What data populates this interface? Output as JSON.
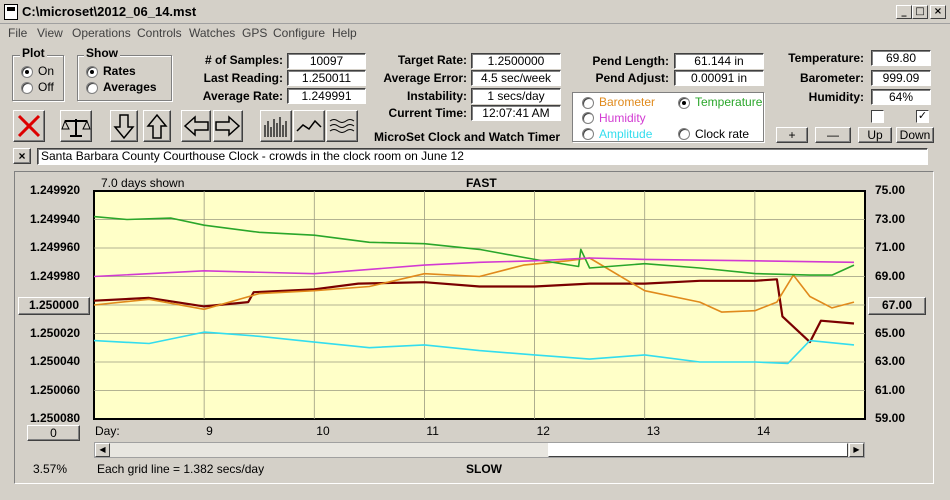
{
  "window": {
    "title": "C:\\microset\\2012_06_14.mst"
  },
  "menu": [
    "File",
    "View",
    "Operations",
    "Controls",
    "Watches",
    "GPS",
    "Configure",
    "Help"
  ],
  "plot": {
    "title": "Plot",
    "on": "On",
    "off": "Off",
    "selected": "On"
  },
  "show": {
    "title": "Show",
    "rates": "Rates",
    "averages": "Averages",
    "selected": "Rates"
  },
  "stats": {
    "samples_label": "# of Samples:",
    "samples": "10097",
    "last_label": "Last Reading:",
    "last": "1.250011",
    "avg_label": "Average Rate:",
    "avg": "1.249991",
    "target_label": "Target Rate:",
    "target": "1.2500000",
    "avg_error_label": "Average Error:",
    "avg_error": "4.5 sec/week",
    "instability_label": "Instability:",
    "instability": "1 secs/day",
    "current_time_label": "Current Time:",
    "current_time": "12:07:41 AM",
    "pend_length_label": "Pend Length:",
    "pend_length": "61.144 in",
    "pend_adjust_label": "Pend Adjust:",
    "pend_adjust": "0.00091 in",
    "temperature_label": "Temperature:",
    "temperature": "69.80",
    "barometer_label": "Barometer:",
    "barometer": "999.09",
    "humidity_label": "Humidity:",
    "humidity": "64%"
  },
  "app_caption": "MicroSet Clock and Watch Timer",
  "sensor_select": {
    "barometer": "Barometer",
    "temperature": "Temperature",
    "humidity": "Humidity",
    "amplitude": "Amplitude",
    "clock_rate": "Clock rate",
    "selected": "Temperature"
  },
  "small_buttons": {
    "plus": "+",
    "minus": "—",
    "up": "Up",
    "down": "Down"
  },
  "description": "Santa Barbara County Courthouse Clock - crowds in the clock room on June 12",
  "chart_header": {
    "days_shown": "7.0 days shown",
    "fast": "FAST",
    "slow": "SLOW",
    "grid_note": "Each grid line = 1.382 secs/day",
    "percent": "3.57%"
  },
  "left_center_button": "1.250000",
  "right_center_button": "67.00",
  "offset_button": "0",
  "colors": {
    "plot_bg": "#ffffc8",
    "rate": "#7a0000",
    "average": "#e08a1c",
    "temperature": "#2aa62a",
    "humidity": "#d23ad2",
    "amplitude": "#33ddee"
  },
  "chart_data": {
    "type": "line",
    "xlabel": "Day:",
    "x_ticks": [
      9,
      10,
      11,
      12,
      13,
      14
    ],
    "xlim": [
      8.0,
      15.0
    ],
    "ylim": [
      1.24992,
      1.25008
    ],
    "y_ticks": [
      "1.249920",
      "1.249940",
      "1.249960",
      "1.249980",
      "1.250000",
      "1.250020",
      "1.250040",
      "1.250060",
      "1.250080"
    ],
    "y2lim": [
      59.0,
      75.0
    ],
    "y2_ticks": [
      "75.00",
      "73.00",
      "71.00",
      "69.00",
      "67.00",
      "65.00",
      "63.00",
      "61.00",
      "59.00"
    ],
    "series": [
      {
        "key": "rate",
        "x": [
          8.0,
          8.5,
          9.0,
          9.4,
          9.45,
          10.0,
          10.4,
          11.0,
          11.5,
          12.0,
          12.5,
          13.0,
          13.5,
          14.0,
          14.2,
          14.25,
          14.5,
          14.6,
          14.9
        ],
        "y": [
          1.249997,
          1.249995,
          1.250001,
          1.249998,
          1.249991,
          1.249989,
          1.249985,
          1.249984,
          1.249987,
          1.249987,
          1.249985,
          1.249985,
          1.249983,
          1.249983,
          1.249982,
          1.250008,
          1.250026,
          1.250011,
          1.250013
        ]
      },
      {
        "key": "average",
        "x": [
          8.0,
          8.5,
          9.0,
          9.5,
          10.0,
          10.5,
          11.0,
          11.5,
          11.9,
          12.3,
          12.5,
          13.0,
          13.5,
          13.7,
          14.0,
          14.2,
          14.35,
          14.5,
          14.7,
          14.9
        ],
        "y": [
          1.25,
          1.249996,
          1.250003,
          1.249992,
          1.24999,
          1.249987,
          1.249978,
          1.24998,
          1.249972,
          1.249969,
          1.249967,
          1.24999,
          1.249998,
          1.250005,
          1.250004,
          1.249998,
          1.249979,
          1.249994,
          1.250002,
          1.249998
        ]
      },
      {
        "key": "temperature",
        "x": [
          8.0,
          8.3,
          8.7,
          9.0,
          9.5,
          10.0,
          10.5,
          11.0,
          11.5,
          12.0,
          12.4,
          12.42,
          12.5,
          13.0,
          13.5,
          14.0,
          14.5,
          14.7,
          14.9
        ],
        "y": [
          73.2,
          73.0,
          73.1,
          72.6,
          72.1,
          71.9,
          71.4,
          71.3,
          70.9,
          70.2,
          69.7,
          70.9,
          69.6,
          69.9,
          69.6,
          69.2,
          69.1,
          69.1,
          69.8
        ]
      },
      {
        "key": "humidity",
        "x": [
          8.0,
          9.0,
          10.0,
          11.0,
          11.5,
          12.0,
          12.5,
          13.0,
          14.0,
          14.9
        ],
        "y": [
          1.24998,
          1.249976,
          1.249978,
          1.249972,
          1.24997,
          1.249969,
          1.249967,
          1.249968,
          1.249969,
          1.24997
        ]
      },
      {
        "key": "amplitude",
        "x": [
          8.0,
          8.5,
          9.0,
          9.5,
          10.0,
          10.5,
          11.0,
          11.5,
          12.0,
          12.5,
          13.0,
          13.5,
          14.0,
          14.3,
          14.5,
          14.9
        ],
        "y": [
          1.250025,
          1.250027,
          1.250019,
          1.250022,
          1.250026,
          1.25003,
          1.250028,
          1.250032,
          1.250035,
          1.250038,
          1.250035,
          1.25004,
          1.25004,
          1.250041,
          1.250025,
          1.250028
        ]
      }
    ]
  }
}
